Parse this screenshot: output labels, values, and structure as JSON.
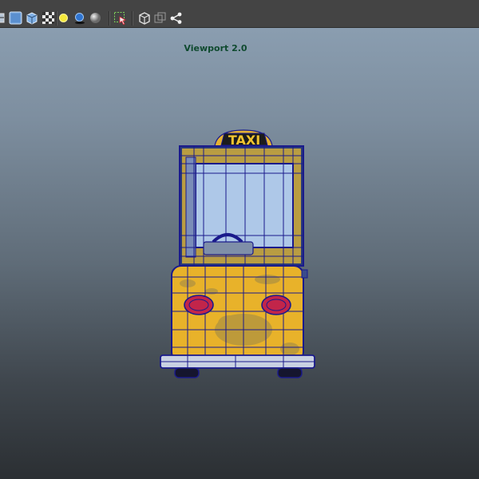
{
  "viewport": {
    "label": "Viewport 2.0",
    "background_top": "#8ea2b5",
    "background_bottom": "#2b2f33"
  },
  "toolbar": {
    "background": "#444444",
    "buttons": [
      {
        "icon": "wireframe-on-shaded-icon"
      },
      {
        "icon": "smooth-shade-icon"
      },
      {
        "icon": "default-material-icon"
      },
      {
        "icon": "textured-icon"
      },
      {
        "icon": "use-all-lights-icon"
      },
      {
        "icon": "shadows-icon"
      },
      {
        "icon": "ambient-occlusion-icon"
      },
      {
        "icon": "isolate-select-icon"
      },
      {
        "icon": "xray-icon"
      },
      {
        "icon": "xray-joints-icon"
      },
      {
        "icon": "share-icon"
      }
    ]
  },
  "model": {
    "name_sign": "TAXI",
    "body_color": "#e8b22a",
    "wire_color": "#1a1a8c",
    "glass_color": "#aec8e8"
  }
}
